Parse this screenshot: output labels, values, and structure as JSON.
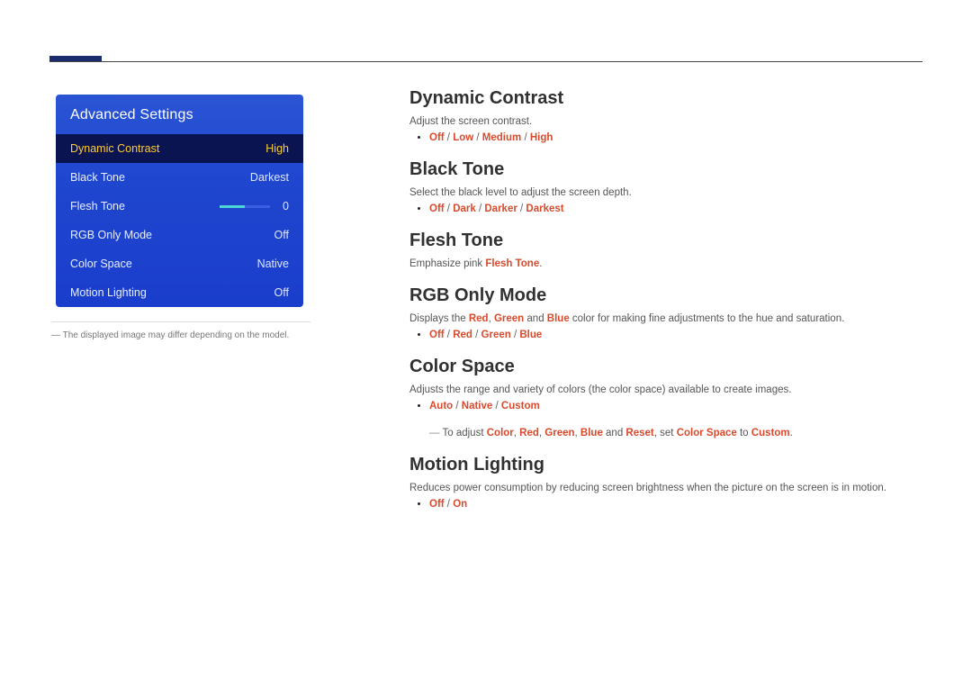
{
  "osd": {
    "title": "Advanced Settings",
    "items": [
      {
        "label": "Dynamic Contrast",
        "value": "High",
        "selected": true,
        "kind": "text"
      },
      {
        "label": "Black Tone",
        "value": "Darkest",
        "kind": "text"
      },
      {
        "label": "Flesh Tone",
        "value": "0",
        "kind": "slider"
      },
      {
        "label": "RGB Only Mode",
        "value": "Off",
        "kind": "text"
      },
      {
        "label": "Color Space",
        "value": "Native",
        "kind": "text"
      },
      {
        "label": "Motion Lighting",
        "value": "Off",
        "kind": "text"
      }
    ]
  },
  "note_prefix": "―",
  "note": "The displayed image may differ depending on the model.",
  "sections": {
    "dynamic_contrast": {
      "heading": "Dynamic Contrast",
      "desc": "Adjust the screen contrast.",
      "options": [
        "Off",
        "Low",
        "Medium",
        "High"
      ]
    },
    "black_tone": {
      "heading": "Black Tone",
      "desc": "Select the black level to adjust the screen depth.",
      "options": [
        "Off",
        "Dark",
        "Darker",
        "Darkest"
      ]
    },
    "flesh_tone": {
      "heading": "Flesh Tone",
      "desc_prefix": "Emphasize pink ",
      "desc_highlight": "Flesh Tone",
      "desc_suffix": "."
    },
    "rgb_only": {
      "heading": "RGB Only Mode",
      "desc_pre": "Displays the ",
      "red": "Red",
      "comma": ", ",
      "green": "Green",
      "and": " and ",
      "blue": "Blue",
      "desc_post": " color for making fine adjustments to the hue and saturation.",
      "options": [
        "Off",
        "Red",
        "Green",
        "Blue"
      ]
    },
    "color_space": {
      "heading": "Color Space",
      "desc": "Adjusts the range and variety of colors (the color space) available to create images.",
      "options": [
        "Auto",
        "Native",
        "Custom"
      ],
      "subnote": {
        "pre": "To adjust ",
        "color": "Color",
        "red": "Red",
        "green": "Green",
        "blue": "Blue",
        "and": " and ",
        "reset": "Reset",
        "set": ", set ",
        "cs": "Color Space",
        "to": " to ",
        "custom": "Custom",
        "end": "."
      }
    },
    "motion_lighting": {
      "heading": "Motion Lighting",
      "desc": "Reduces power consumption by reducing screen brightness when the picture on the screen is in motion.",
      "options": [
        "Off",
        "On"
      ]
    }
  },
  "opt_sep": " / "
}
